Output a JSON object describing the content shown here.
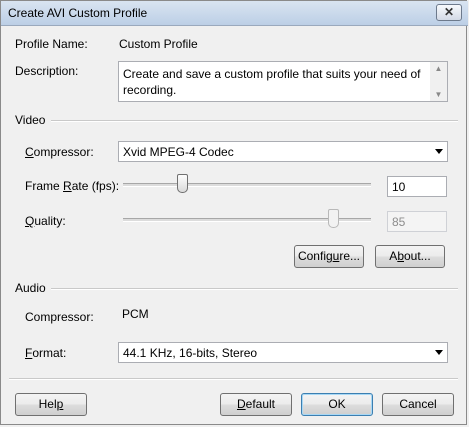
{
  "window": {
    "title": "Create AVI Custom Profile",
    "close_glyph": "✕"
  },
  "profile": {
    "name_label": "Profile Name:",
    "name_value": "Custom Profile",
    "description_label": "Description:",
    "description_value": "Create and save a custom profile that suits your need of recording."
  },
  "video": {
    "group_label": "Video",
    "compressor_label": "Compressor:",
    "compressor_value": "Xvid MPEG-4 Codec",
    "frame_rate_label": "Frame Rate (fps):",
    "frame_rate_value": "10",
    "frame_rate_slider_fraction": 0.24,
    "quality_label": "Quality:",
    "quality_value": "85",
    "quality_slider_fraction": 0.85,
    "configure_label": "Configure...",
    "about_label": "About..."
  },
  "audio": {
    "group_label": "Audio",
    "compressor_label": "Compressor:",
    "compressor_value": "PCM",
    "format_label": "Format:",
    "format_value": "44.1 KHz, 16-bits, Stereo"
  },
  "buttons": {
    "help": "Help",
    "default": "Default",
    "ok": "OK",
    "cancel": "Cancel"
  }
}
